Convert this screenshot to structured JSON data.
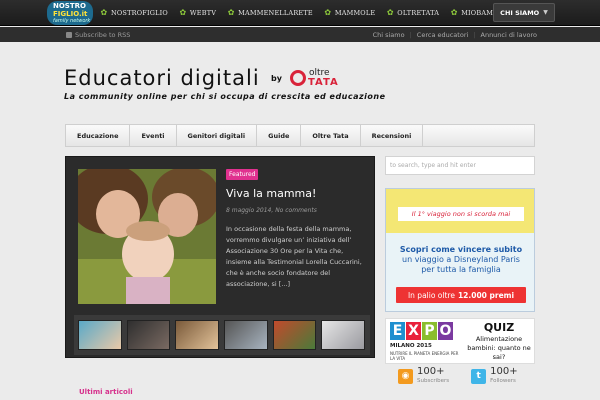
{
  "network": {
    "logo": {
      "line1": "NOSTRO",
      "line2": "FIGLIO.it",
      "line3": "family network"
    },
    "items": [
      {
        "label": "NOSTROFIGLIO",
        "icon": "leaf-icon"
      },
      {
        "label": "WEBTV",
        "icon": "leaf-icon"
      },
      {
        "label": "MAMMENELLARETE",
        "icon": "leaf-icon"
      },
      {
        "label": "MAMMOLE",
        "icon": "leaf-icon"
      },
      {
        "label": "OLTRETATA",
        "icon": "leaf-icon"
      },
      {
        "label": "MIOBAMBINO",
        "icon": "leaf-icon"
      }
    ],
    "menu_button": "CHI SIAMO"
  },
  "subbar": {
    "subscribe": "Subscribe to RSS",
    "links": [
      "Chi siamo",
      "Cerca educatori",
      "Annunci di lavoro"
    ]
  },
  "brand": {
    "title": "Educatori digitali",
    "by": "by",
    "logo_top": "oltre",
    "logo_bottom": "TATA",
    "tagline": "La community online per chi si occupa di crescita ed educazione"
  },
  "nav": [
    "Educazione",
    "Eventi",
    "Genitori digitali",
    "Guide",
    "Oltre Tata",
    "Recensioni"
  ],
  "search": {
    "placeholder": "to search, type and hit enter"
  },
  "featured": {
    "badge": "Featured",
    "title": "Viva la mamma!",
    "meta": "8 maggio 2014, No comments",
    "excerpt": "In occasione della festa della mamma, vorremmo divulgare un’ iniziativa dell’ Associazione 30 Ore per la Vita che, insieme alla Testimonial Lorella Cuccarini, che è anche socio fondatore del associazione, si [...]",
    "thumbnail_count_label": ""
  },
  "ad_disney": {
    "banner": "Il 1° viaggio non si scorda mai",
    "line1": "Scopri come vincere subito",
    "line2": "un viaggio a Disneyland Paris",
    "line3": "per tutta la famiglia",
    "prize_prefix": "In palio oltre",
    "prize_value": "12.000 premi"
  },
  "ad_expo": {
    "letters": [
      "E",
      "X",
      "P",
      "O"
    ],
    "city": "MILANO 2015",
    "motto": "NUTRIRE IL PIANETA ENERGIA PER LA VITA",
    "quiz_title": "QUIZ",
    "quiz_text": "Alimentazione bambini: quanto ne sai?"
  },
  "social": {
    "rss": {
      "count": "100+",
      "label": "Subscribers"
    },
    "twitter": {
      "count": "100+",
      "label": "Followers"
    }
  },
  "latest": {
    "heading": "Ultimi articoli"
  }
}
